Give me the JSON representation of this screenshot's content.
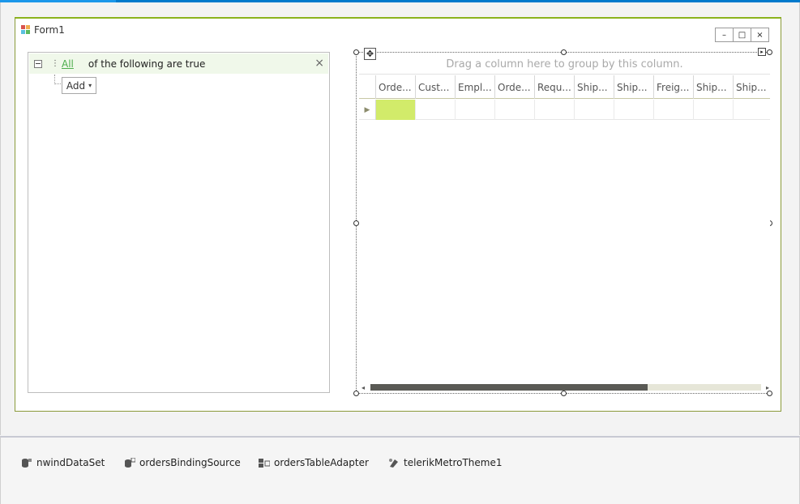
{
  "form": {
    "title": "Form1"
  },
  "title_buttons": {
    "minimize": "–",
    "maximize": "□",
    "close": "×"
  },
  "filter": {
    "operator": "All",
    "condition_text": "of the following are true",
    "close_glyph": "×",
    "add_label": "Add",
    "add_caret": "▾"
  },
  "grid": {
    "group_panel_text": "Drag a column here to group by this column.",
    "columns": [
      "Orde...",
      "Cust...",
      "Empl...",
      "Orde...",
      "Requ...",
      "Ship...",
      "Ship...",
      "Freig...",
      "Ship...",
      "Ship..."
    ],
    "row_indicator": "▶",
    "move_glyph": "✥",
    "smart_tag": "▸"
  },
  "scrollbar": {
    "left_arrow": "◂",
    "right_arrow": "▸",
    "thumb_fraction": 0.71
  },
  "tray": {
    "items": [
      {
        "label": "nwindDataSet",
        "icon": "dataset-icon"
      },
      {
        "label": "ordersBindingSource",
        "icon": "binding-source-icon"
      },
      {
        "label": "ordersTableAdapter",
        "icon": "table-adapter-icon"
      },
      {
        "label": "telerikMetroTheme1",
        "icon": "theme-icon"
      }
    ]
  },
  "colors": {
    "accent": "#007acc",
    "current_cell": "#d2eb6a",
    "form_border": "#8bb31c",
    "link": "#4cae4c"
  }
}
